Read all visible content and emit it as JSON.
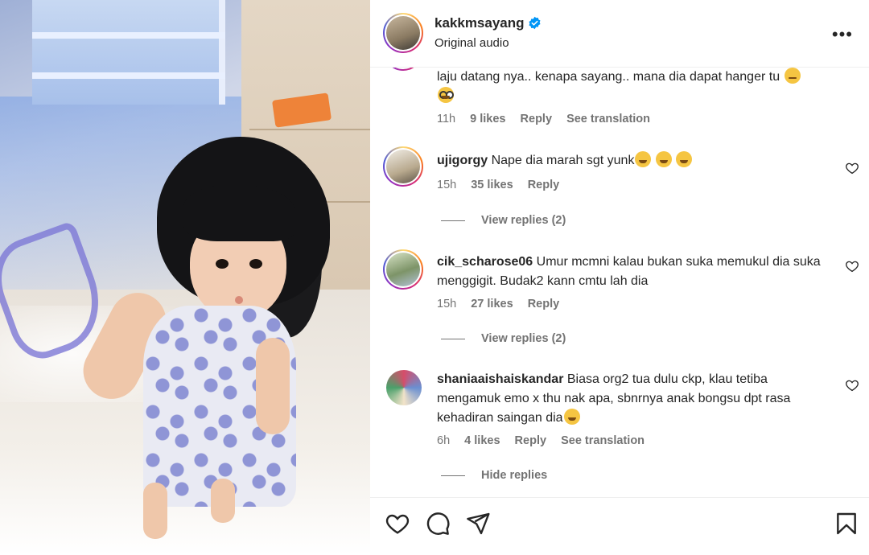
{
  "post": {
    "username": "kakkmsayang",
    "subtitle": "Original audio",
    "more_label": "•••"
  },
  "comments": [
    {
      "username": "",
      "text": "laju datang nya.. kenapa sayang.. mana dia dapat hanger tu",
      "emojis": [
        "worried-face-icon",
        "nerd-face-icon"
      ],
      "time": "11h",
      "likes": "9 likes",
      "reply": "Reply",
      "translation": "See translation"
    },
    {
      "username": "ujigorgy",
      "text": "Nape dia marah sgt yunk",
      "emojis": [
        "joy-face-icon",
        "joy-face-icon",
        "joy-face-icon"
      ],
      "time": "15h",
      "likes": "35 likes",
      "reply": "Reply",
      "view_replies": "View replies (2)"
    },
    {
      "username": "cik_scharose06",
      "text": "Umur mcmni kalau bukan suka memukul dia suka menggigit. Budak2 kann cmtu lah dia",
      "time": "15h",
      "likes": "27 likes",
      "reply": "Reply",
      "view_replies": "View replies (2)"
    },
    {
      "username": "shaniaaishaiskandar",
      "text": "Biasa org2 tua dulu ckp, klau tetiba mengamuk emo x thu nak apa, sbnrnya anak bongsu dpt rasa kehadiran saingan dia",
      "emojis": [
        "joy-face-icon"
      ],
      "time": "6h",
      "likes": "4 likes",
      "reply": "Reply",
      "translation": "See translation",
      "hide_replies": "Hide replies"
    }
  ],
  "actions": [
    "heart-icon",
    "comment-icon",
    "share-icon",
    "bookmark-icon"
  ],
  "colors": {
    "text": "#262626",
    "muted": "#737373",
    "verified": "#0095f6"
  }
}
